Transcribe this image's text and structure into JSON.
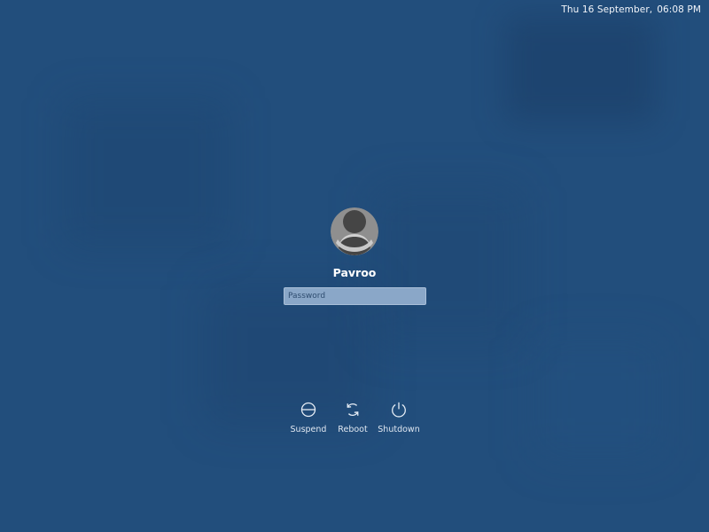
{
  "theme": {
    "background": "#224e7c",
    "text": "#ffffff",
    "avatar_bg": "#8f8f8f",
    "avatar_figure": "#454545",
    "field_bg": "#8aa7c8"
  },
  "top_bar": {
    "date": "Thu 16 September,",
    "time": "06:08 PM"
  },
  "login": {
    "avatar_icon": "user-avatar-icon",
    "username": "Pavroo",
    "password": {
      "value": "",
      "placeholder": "Password"
    }
  },
  "power_actions": [
    {
      "label": "Suspend",
      "icon": "suspend-icon"
    },
    {
      "label": "Reboot",
      "icon": "reboot-icon"
    },
    {
      "label": "Shutdown",
      "icon": "power-icon"
    }
  ]
}
